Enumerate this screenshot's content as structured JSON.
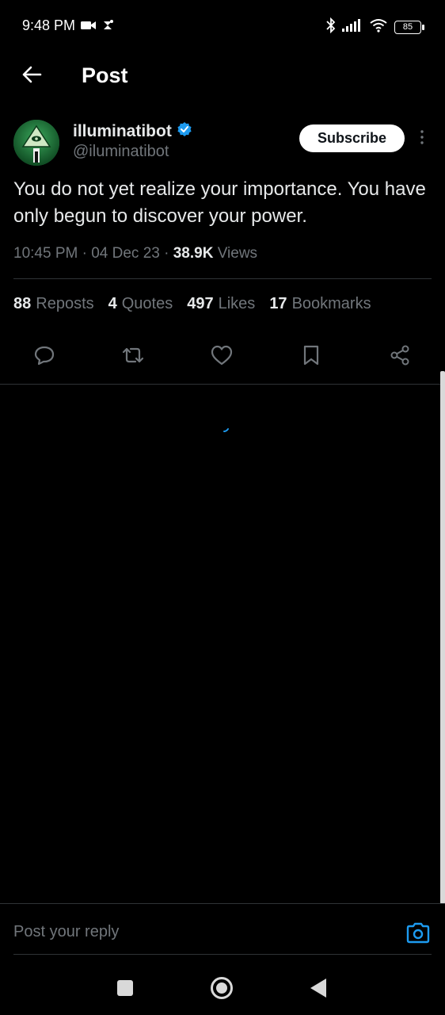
{
  "status_bar": {
    "time": "9:48 PM",
    "battery": "85",
    "icons": [
      "video-camera-icon",
      "notification-icon",
      "bluetooth-icon",
      "signal-icon",
      "wifi-icon",
      "battery-icon"
    ]
  },
  "header": {
    "title": "Post",
    "back_icon": "arrow-left-icon"
  },
  "post": {
    "display_name": "illuminatibot",
    "handle": "@iluminatibot",
    "verified": true,
    "subscribe_label": "Subscribe",
    "text": "You do not yet realize your importance. You have only begun to discover your power.",
    "time": "10:45 PM",
    "separator": "·",
    "date": "04 Dec 23",
    "views_count": "38.9K",
    "views_label": "Views"
  },
  "stats": [
    {
      "count": "88",
      "label": "Reposts"
    },
    {
      "count": "4",
      "label": "Quotes"
    },
    {
      "count": "497",
      "label": "Likes"
    },
    {
      "count": "17",
      "label": "Bookmarks"
    }
  ],
  "actions": [
    "reply-icon",
    "repost-icon",
    "like-icon",
    "bookmark-icon",
    "share-icon"
  ],
  "reply": {
    "placeholder": "Post your reply"
  },
  "colors": {
    "background": "#000000",
    "text": "#e7e9ea",
    "secondary": "#71767b",
    "accent": "#1d9bf0",
    "divider": "#2f3336"
  }
}
